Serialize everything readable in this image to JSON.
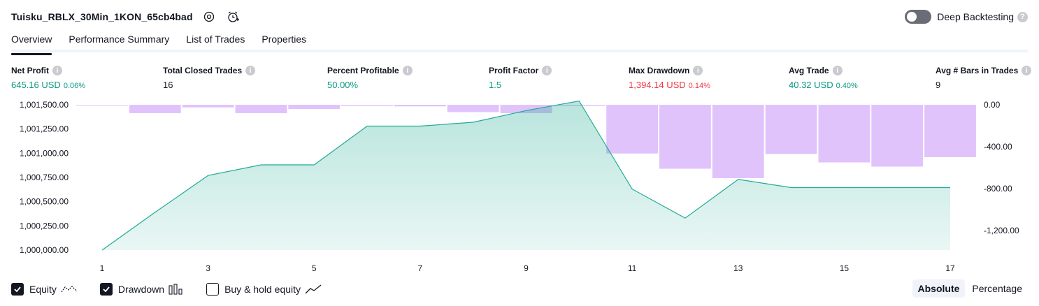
{
  "header": {
    "strategy_name": "Tuisku_RBLX_30Min_1KON_65cb4bad",
    "deep_backtesting_label": "Deep Backtesting",
    "icons": [
      "settings-icon",
      "alert-clock-icon",
      "help-icon"
    ]
  },
  "tabs": [
    {
      "label": "Overview",
      "active": true
    },
    {
      "label": "Performance Summary",
      "active": false
    },
    {
      "label": "List of Trades",
      "active": false
    },
    {
      "label": "Properties",
      "active": false
    }
  ],
  "metrics": [
    {
      "label": "Net Profit",
      "value": "645.16 USD",
      "pct": "0.06%",
      "color": "#089981"
    },
    {
      "label": "Total Closed Trades",
      "value": "16",
      "pct": "",
      "color": "#131722"
    },
    {
      "label": "Percent Profitable",
      "value": "50.00%",
      "pct": "",
      "color": "#089981"
    },
    {
      "label": "Profit Factor",
      "value": "1.5",
      "pct": "",
      "color": "#089981"
    },
    {
      "label": "Max Drawdown",
      "value": "1,394.14 USD",
      "pct": "0.14%",
      "color": "#f23645"
    },
    {
      "label": "Avg Trade",
      "value": "40.32 USD",
      "pct": "0.40%",
      "color": "#089981"
    },
    {
      "label": "Avg # Bars in Trades",
      "value": "9",
      "pct": "",
      "color": "#131722"
    }
  ],
  "chart_data": {
    "type": "area",
    "x": [
      1,
      2,
      3,
      4,
      5,
      6,
      7,
      8,
      9,
      10,
      11,
      12,
      13,
      14,
      15,
      16,
      17
    ],
    "xticks": [
      "1",
      "3",
      "5",
      "7",
      "9",
      "11",
      "13",
      "15",
      "17"
    ],
    "xlim": [
      1,
      17
    ],
    "series": [
      {
        "name": "Equity",
        "type": "area",
        "axis": "left",
        "color": "#22ab94",
        "values": [
          1000000.0,
          1000390.0,
          1000770.0,
          1000880.0,
          1000880.0,
          1001280.0,
          1001280.0,
          1001320.0,
          1001440.0,
          1001540.0,
          1000630.0,
          1000330.0,
          1000730.0,
          1000645.16,
          1000645.16,
          1000645.16,
          1000645.16
        ]
      },
      {
        "name": "Drawdown",
        "type": "bar",
        "axis": "right",
        "color": "#e1c3fc",
        "values": [
          0,
          -80,
          -25,
          -80,
          -40,
          -10,
          -15,
          -70,
          -80,
          -10,
          -465,
          -610,
          -700,
          -470,
          -550,
          -590,
          -500
        ]
      }
    ],
    "left_axis": {
      "ylim": [
        1000000,
        1001500
      ],
      "ticks": [
        "1,001,500.00",
        "1,001,250.00",
        "1,001,000.00",
        "1,000,750.00",
        "1,000,500.00",
        "1,000,250.00",
        "1,000,000.00"
      ],
      "tick_values": [
        1001500,
        1001250,
        1001000,
        1000750,
        1000500,
        1000250,
        1000000
      ]
    },
    "right_axis": {
      "ylim": [
        -1400,
        0
      ],
      "ticks": [
        "0.00",
        "-400.00",
        "-800.00",
        "-1,200.00"
      ],
      "tick_values": [
        0,
        -400,
        -800,
        -1200
      ]
    },
    "grid": false
  },
  "footer": {
    "legend": [
      {
        "label": "Equity",
        "checked": true,
        "icon": "equity-line-icon"
      },
      {
        "label": "Drawdown",
        "checked": true,
        "icon": "drawdown-bars-icon"
      },
      {
        "label": "Buy & hold equity",
        "checked": false,
        "icon": "buy-hold-line-icon"
      }
    ],
    "modes": [
      {
        "label": "Absolute",
        "active": true
      },
      {
        "label": "Percentage",
        "active": false
      }
    ]
  }
}
